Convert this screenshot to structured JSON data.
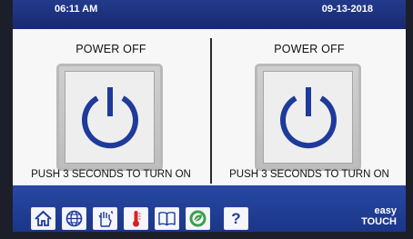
{
  "status_bar": {
    "time": "06:11 AM",
    "date": "09-13-2018"
  },
  "panels": [
    {
      "title": "POWER OFF",
      "hint": "PUSH 3 SECONDS TO TURN ON",
      "button_icon": "power-icon"
    },
    {
      "title": "POWER OFF",
      "hint": "PUSH 3 SECONDS TO TURN ON",
      "button_icon": "power-icon"
    }
  ],
  "nav": {
    "buttons": [
      {
        "icon": "home-icon"
      },
      {
        "icon": "globe-icon"
      },
      {
        "icon": "cleaning-hand-icon"
      },
      {
        "icon": "thermometer-icon"
      },
      {
        "icon": "book-icon"
      },
      {
        "icon": "eco-leaf-icon"
      },
      {
        "icon": "help-icon",
        "label": "?"
      }
    ]
  },
  "brand": {
    "line1": "easy",
    "line2": "TOUCH"
  },
  "colors": {
    "header_blue": "#1f3480",
    "nav_blue": "#2244a0",
    "power_icon_blue": "#1e3a9a",
    "thermometer_red": "#d42424",
    "eco_green": "#3aa04a"
  }
}
